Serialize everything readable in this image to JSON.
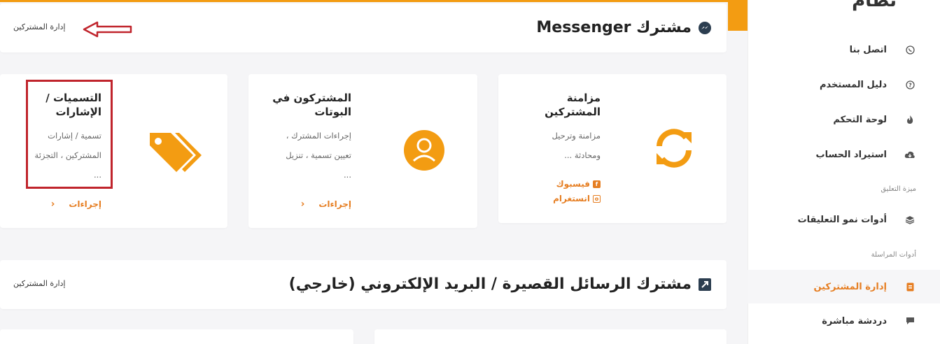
{
  "sidebar": {
    "brand": "نظام",
    "items": [
      {
        "label": "اتصل بنا",
        "icon": "whatsapp-icon"
      },
      {
        "label": "دليل المستخدم",
        "icon": "question-circle-icon"
      },
      {
        "label": "لوحة التحكم",
        "icon": "fire-icon"
      },
      {
        "label": "استيراد الحساب",
        "icon": "cloud-download-icon"
      }
    ],
    "section_comments": "ميزة التعليق",
    "comments_item": {
      "label": "أدوات نمو التعليقات",
      "icon": "layers-icon"
    },
    "section_messaging": "أدوات المراسلة",
    "messaging_items": [
      {
        "label": "إدارة المشتركين",
        "icon": "subscriber-book-icon",
        "active": true
      },
      {
        "label": "دردشة مباشرة",
        "icon": "chat-bubble-icon",
        "active": false
      }
    ]
  },
  "header1": {
    "title": "مشترك Messenger",
    "link": "إدارة المشتركين",
    "icon": "messenger-icon"
  },
  "cards": {
    "sync": {
      "title": "مزامنة\nالمشتركين",
      "desc": "مزامنة وترحيل\nومحادثة ...",
      "facebook": "فيسبوك",
      "instagram": "انستغرام",
      "icon": "sync-icon"
    },
    "bots": {
      "title": "المشتركون في\nالبوتات",
      "desc": "إجراءات المشترك ،\nتعيين تسمية ، تنزيل\n...",
      "action": "إجراءات",
      "icon": "user-circle-icon"
    },
    "labels": {
      "title": "التسميات /\nالإشارات",
      "desc": "تسمية / إشارات\nالمشتركين ، التجزئة\n...",
      "action": "إجراءات",
      "icon": "tags-icon"
    }
  },
  "header2": {
    "title": "مشترك الرسائل القصيرة / البريد الإلكتروني (خارجي)",
    "link": "إدارة المشتركين",
    "icon": "external-link-icon"
  },
  "colors": {
    "accent": "#f39c12",
    "link": "#e67e22",
    "annotation": "#c0242c"
  }
}
